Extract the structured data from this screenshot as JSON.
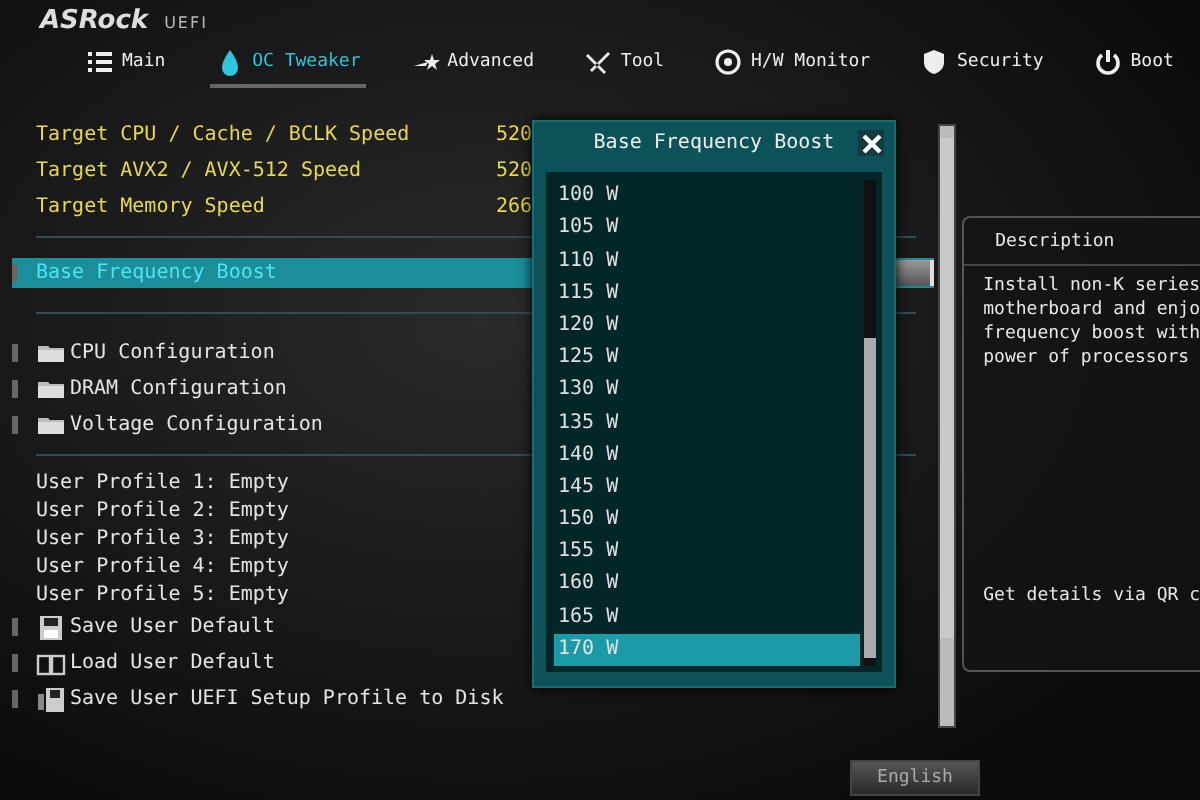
{
  "header": {
    "logo": "ASRock",
    "logo_sub": "UEFI"
  },
  "tabs": [
    {
      "label": "Main",
      "selected": false
    },
    {
      "label": "OC Tweaker",
      "selected": true
    },
    {
      "label": "Advanced",
      "selected": false
    },
    {
      "label": "Tool",
      "selected": false
    },
    {
      "label": "H/W Monitor",
      "selected": false
    },
    {
      "label": "Security",
      "selected": false
    },
    {
      "label": "Boot",
      "selected": false
    }
  ],
  "settings": [
    {
      "kind": "info",
      "label": "Target CPU / Cache / BCLK Speed",
      "value": "520",
      "selected": false
    },
    {
      "kind": "info",
      "label": "Target AVX2 / AVX-512 Speed",
      "value": "520",
      "selected": false
    },
    {
      "kind": "info",
      "label": "Target Memory Speed",
      "value": "266",
      "selected": false
    },
    {
      "kind": "option",
      "label": "Base Frequency Boost",
      "selected": true
    },
    {
      "kind": "folder",
      "label": "CPU Configuration",
      "selected": false
    },
    {
      "kind": "folder",
      "label": "DRAM Configuration",
      "selected": false
    },
    {
      "kind": "folder",
      "label": "Voltage Configuration",
      "selected": false
    },
    {
      "kind": "profile",
      "label": "User Profile 1: Empty",
      "selected": false
    },
    {
      "kind": "profile",
      "label": "User Profile 2: Empty",
      "selected": false
    },
    {
      "kind": "profile",
      "label": "User Profile 3: Empty",
      "selected": false
    },
    {
      "kind": "profile",
      "label": "User Profile 4: Empty",
      "selected": false
    },
    {
      "kind": "profile",
      "label": "User Profile 5: Empty",
      "selected": false
    },
    {
      "kind": "save",
      "label": "Save User Default",
      "selected": false
    },
    {
      "kind": "load",
      "label": "Load User Default",
      "selected": false
    },
    {
      "kind": "export",
      "label": "Save User UEFI Setup Profile to Disk",
      "selected": false
    }
  ],
  "dialog": {
    "title": "Base Frequency Boost",
    "options": [
      {
        "label": "100 W",
        "selected": false
      },
      {
        "label": "105 W",
        "selected": false
      },
      {
        "label": "110 W",
        "selected": false
      },
      {
        "label": "115 W",
        "selected": false
      },
      {
        "label": "120 W",
        "selected": false
      },
      {
        "label": "125 W",
        "selected": false
      },
      {
        "label": "130 W",
        "selected": false
      },
      {
        "label": "135 W",
        "selected": false
      },
      {
        "label": "140 W",
        "selected": false
      },
      {
        "label": "145 W",
        "selected": false
      },
      {
        "label": "150 W",
        "selected": false
      },
      {
        "label": "155 W",
        "selected": false
      },
      {
        "label": "160 W",
        "selected": false
      },
      {
        "label": "165 W",
        "selected": false
      },
      {
        "label": "170 W",
        "selected": true
      }
    ]
  },
  "description": {
    "title": "Description",
    "lines": [
      "Install non-K series",
      "motherboard and enjo",
      "frequency boost with",
      "power of processors"
    ],
    "footer": "Get details via QR c"
  },
  "footer_buttons": [
    {
      "label": "English"
    }
  ]
}
